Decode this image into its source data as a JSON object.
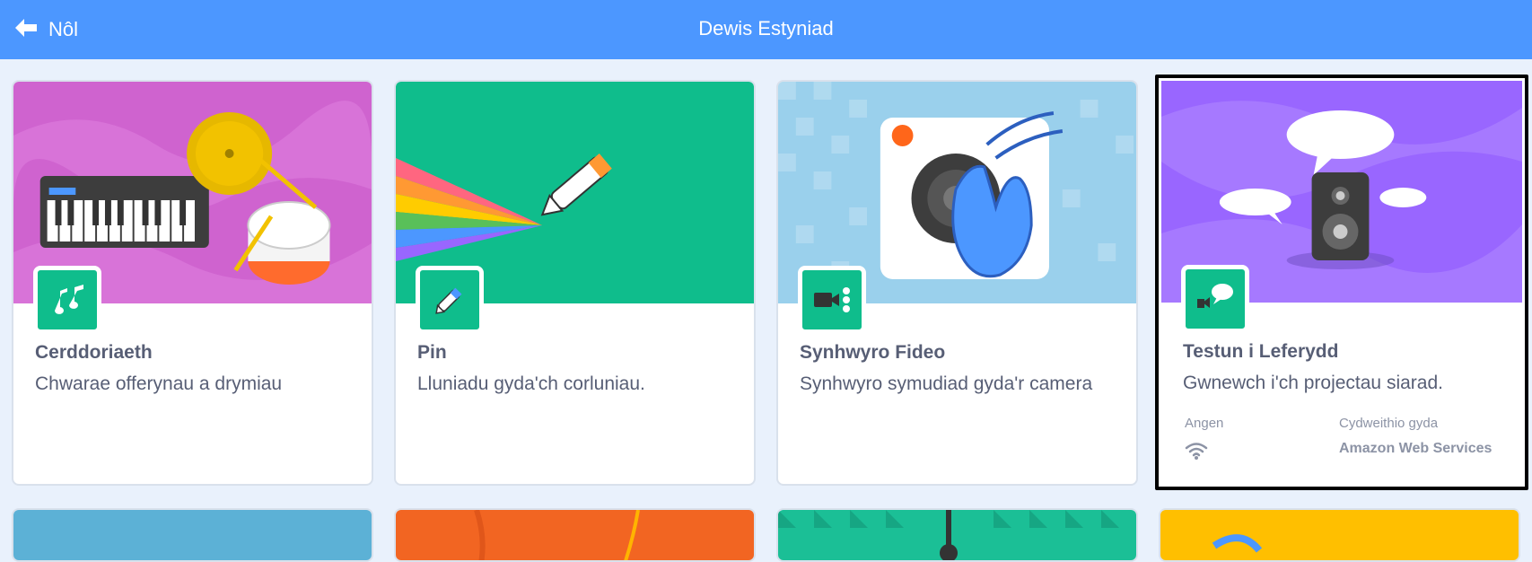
{
  "header": {
    "back_label": "Nôl",
    "title": "Dewis Estyniad"
  },
  "cards": [
    {
      "title": "Cerddoriaeth",
      "description": "Chwarae offerynau a drymiau",
      "icon": "music-notes-icon"
    },
    {
      "title": "Pin",
      "description": "Lluniadu gyda'ch corluniau.",
      "icon": "pen-icon"
    },
    {
      "title": "Synhwyro Fideo",
      "description": "Synhwyro symudiad gyda'r camera",
      "icon": "video-camera-icon"
    },
    {
      "title": "Testun i Leferydd",
      "description": "Gwnewch i'ch projectau siarad.",
      "icon": "speaker-speech-icon",
      "requires_label": "Angen",
      "requires_icon": "wifi-icon",
      "collaboration_label": "Cydweithio gyda",
      "collaborator": "Amazon Web Services",
      "selected": true
    }
  ],
  "colors": {
    "header": "#4c97ff",
    "icon_bg": "#0fbd8c",
    "text": "#575e75",
    "music_bg": "#cf63cf",
    "pen_bg": "#0fbd8c",
    "video_bg": "#9ad0ec",
    "speech_bg": "#9966ff"
  }
}
